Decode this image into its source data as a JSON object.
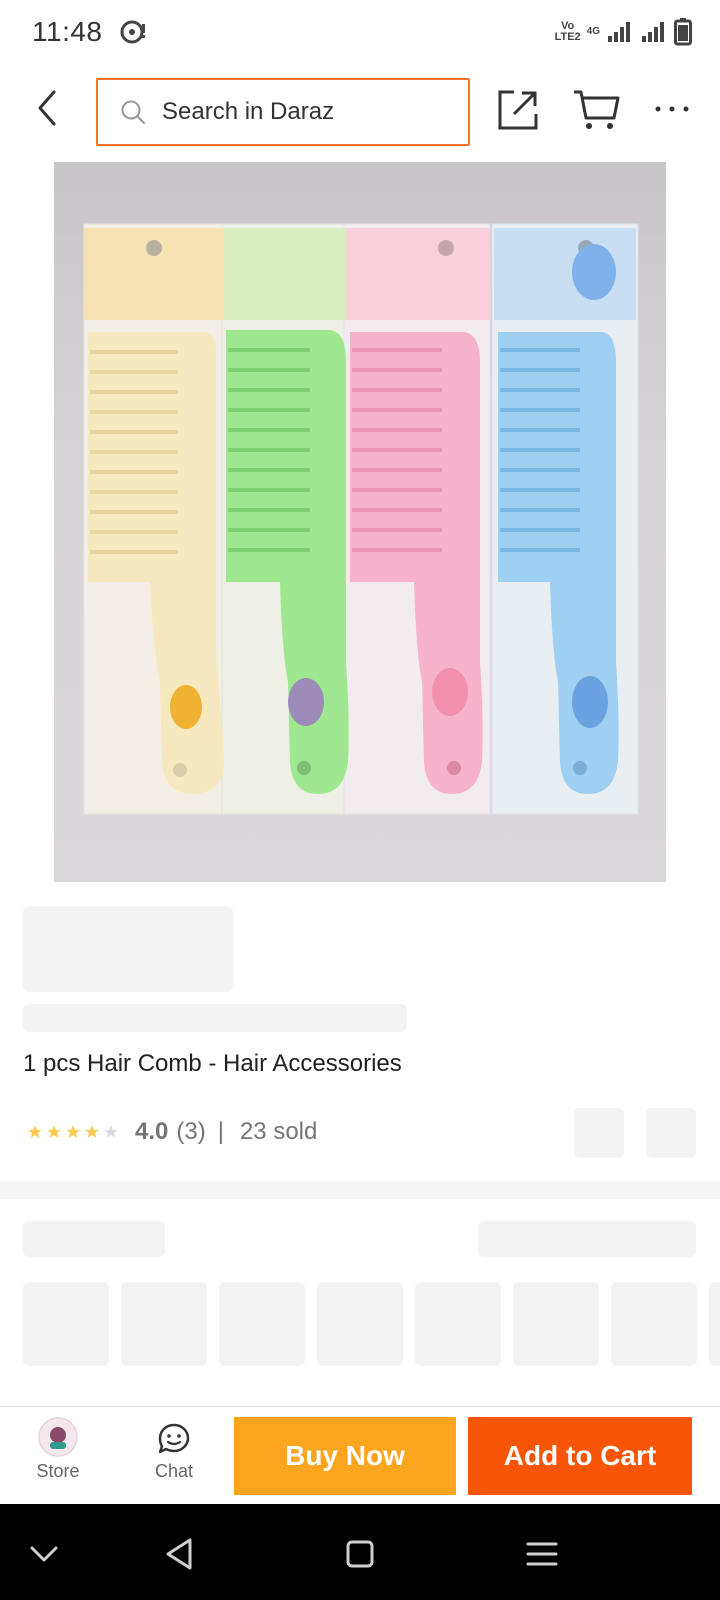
{
  "status_bar": {
    "time": "11:48",
    "volte_line1": "Vo",
    "volte_line2": "LTE2",
    "network": "4G"
  },
  "header": {
    "search_placeholder": "Search in Daraz",
    "accent_color": "#f57224"
  },
  "product": {
    "image_alt": "Four pastel hair combs in packaging: yellow, green, pink, blue",
    "title": "1 pcs Hair Comb - Hair Accessories",
    "rating": {
      "stars_filled": 4,
      "stars_total": 5,
      "value": "4.0",
      "count": "(3)",
      "separator": "|",
      "sold": "23 sold"
    }
  },
  "bottom_bar": {
    "store_label": "Store",
    "chat_label": "Chat",
    "buy_now_label": "Buy Now",
    "add_to_cart_label": "Add to Cart",
    "buy_now_color": "#fca61f",
    "add_to_cart_color": "#f85606"
  },
  "nav_bar": {
    "icons": [
      "chevron-down-icon",
      "back-triangle-icon",
      "home-square-icon",
      "menu-icon"
    ]
  }
}
